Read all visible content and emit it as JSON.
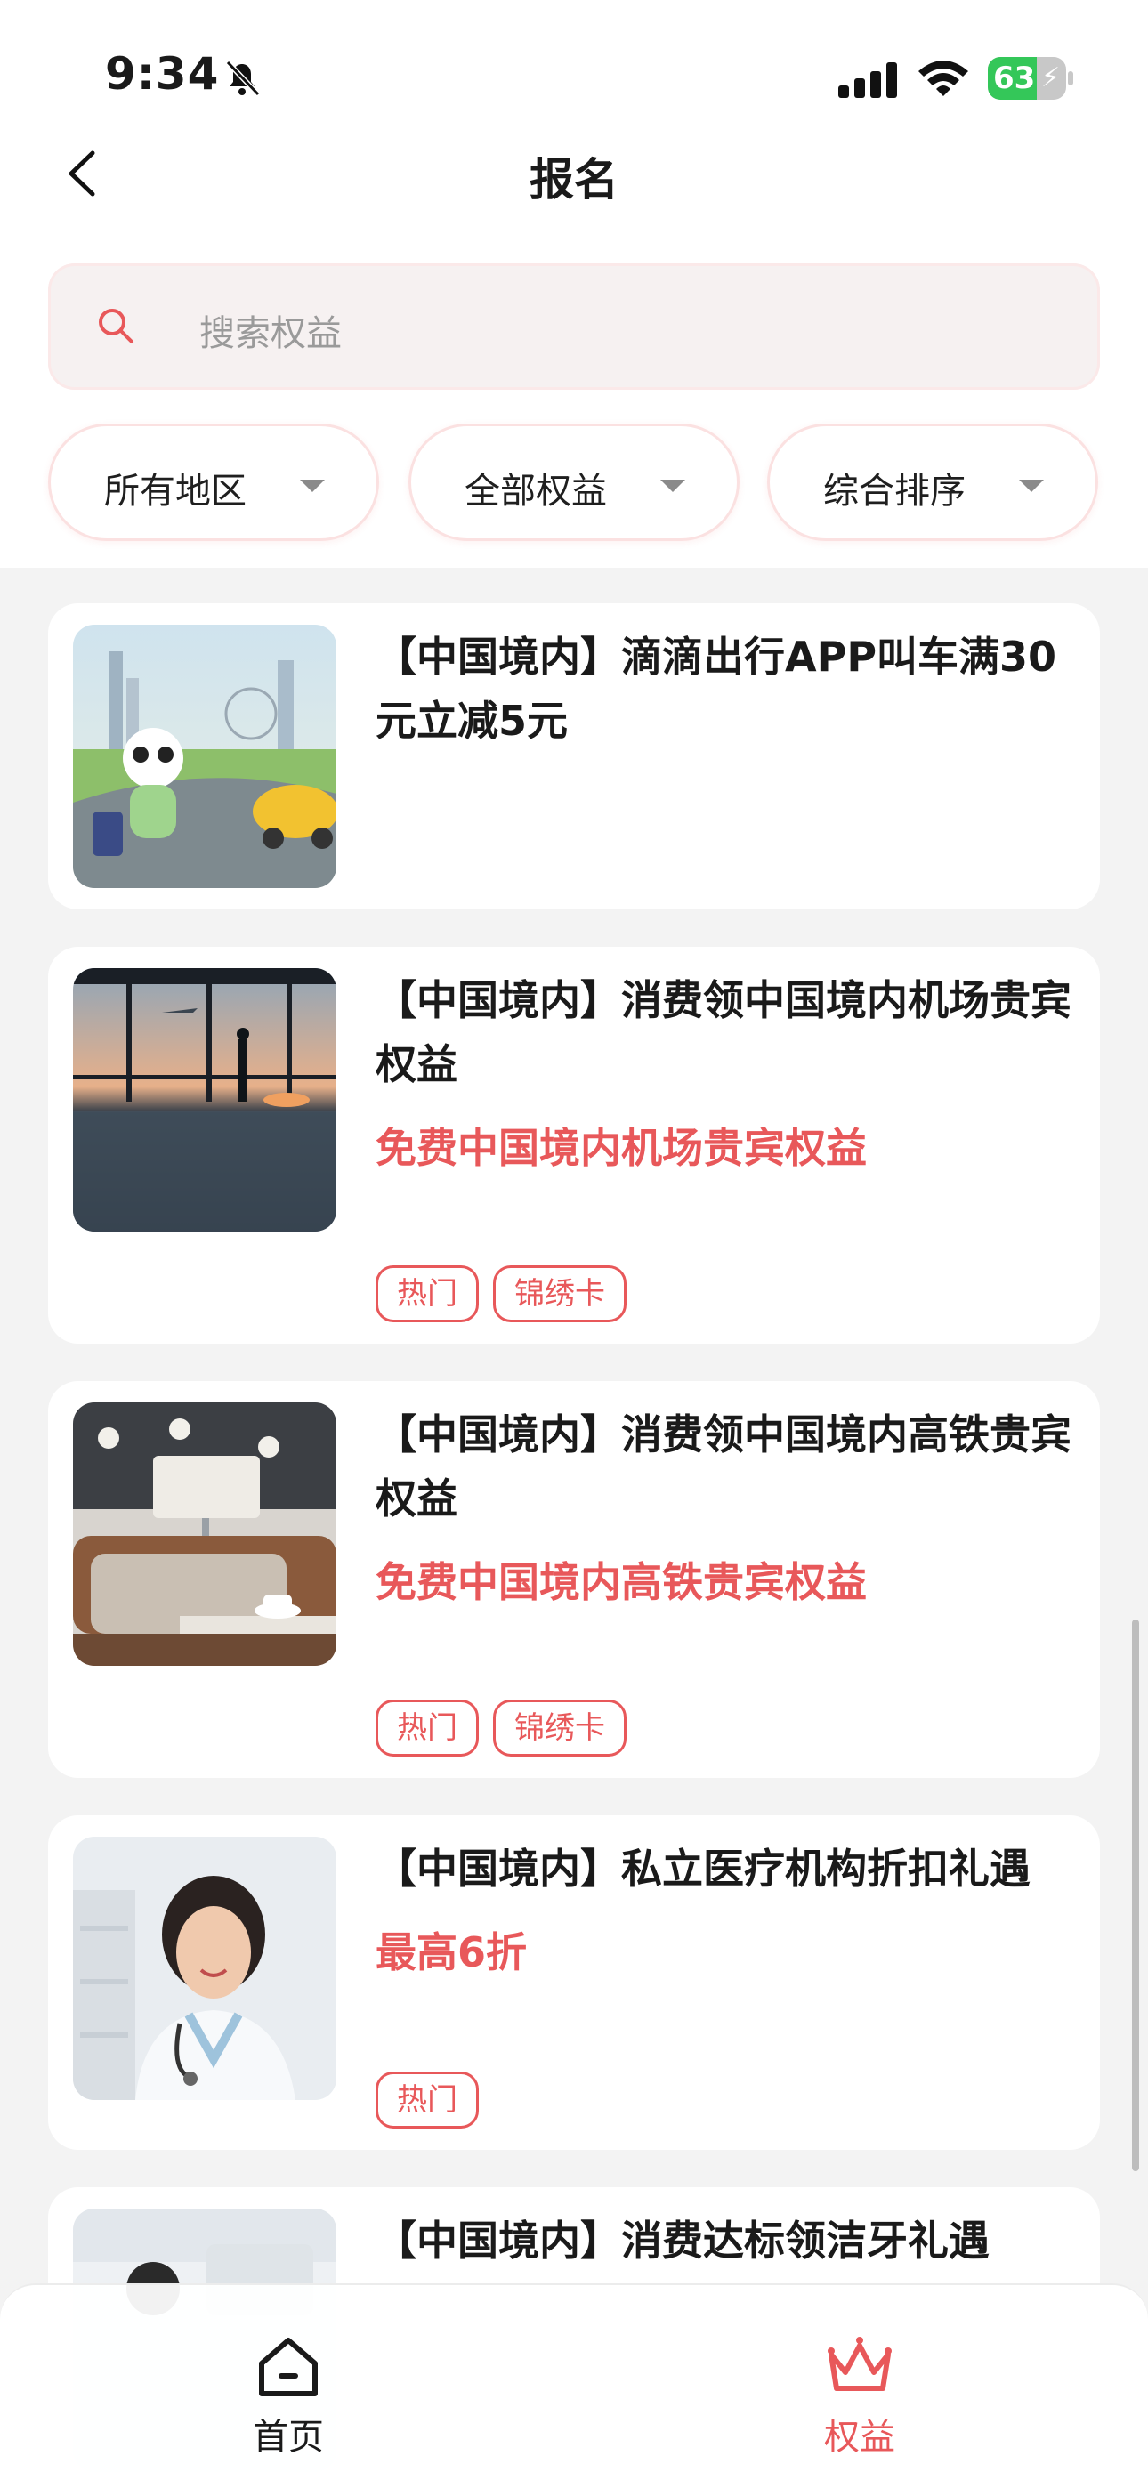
{
  "status": {
    "time": "9:34",
    "battery": "63",
    "battery_level": 0.63
  },
  "nav": {
    "title": "报名"
  },
  "search": {
    "placeholder": "搜索权益"
  },
  "filters": [
    {
      "label": "所有地区"
    },
    {
      "label": "全部权益"
    },
    {
      "label": "综合排序"
    }
  ],
  "cards": [
    {
      "title": "【中国境内】滴滴出行APP叫车满30元立减5元",
      "subtitle": "",
      "tags": []
    },
    {
      "title": "【中国境内】消费领中国境内机场贵宾权益",
      "subtitle": "免费中国境内机场贵宾权益",
      "tags": [
        "热门",
        "锦绣卡"
      ]
    },
    {
      "title": "【中国境内】消费领中国境内高铁贵宾权益",
      "subtitle": "免费中国境内高铁贵宾权益",
      "tags": [
        "热门",
        "锦绣卡"
      ]
    },
    {
      "title": "【中国境内】私立医疗机构折扣礼遇",
      "subtitle": "最高6折",
      "tags": [
        "热门"
      ]
    },
    {
      "title": "【中国境内】消费达标领洁牙礼遇",
      "subtitle": "",
      "tags": []
    }
  ],
  "tabbar": {
    "items": [
      {
        "label": "首页",
        "icon": "home-icon",
        "active": false
      },
      {
        "label": "权益",
        "icon": "crown-icon",
        "active": true
      }
    ]
  },
  "colors": {
    "accent": "#e8585a",
    "background": "#f3f3f3",
    "battery": "#34c759"
  }
}
